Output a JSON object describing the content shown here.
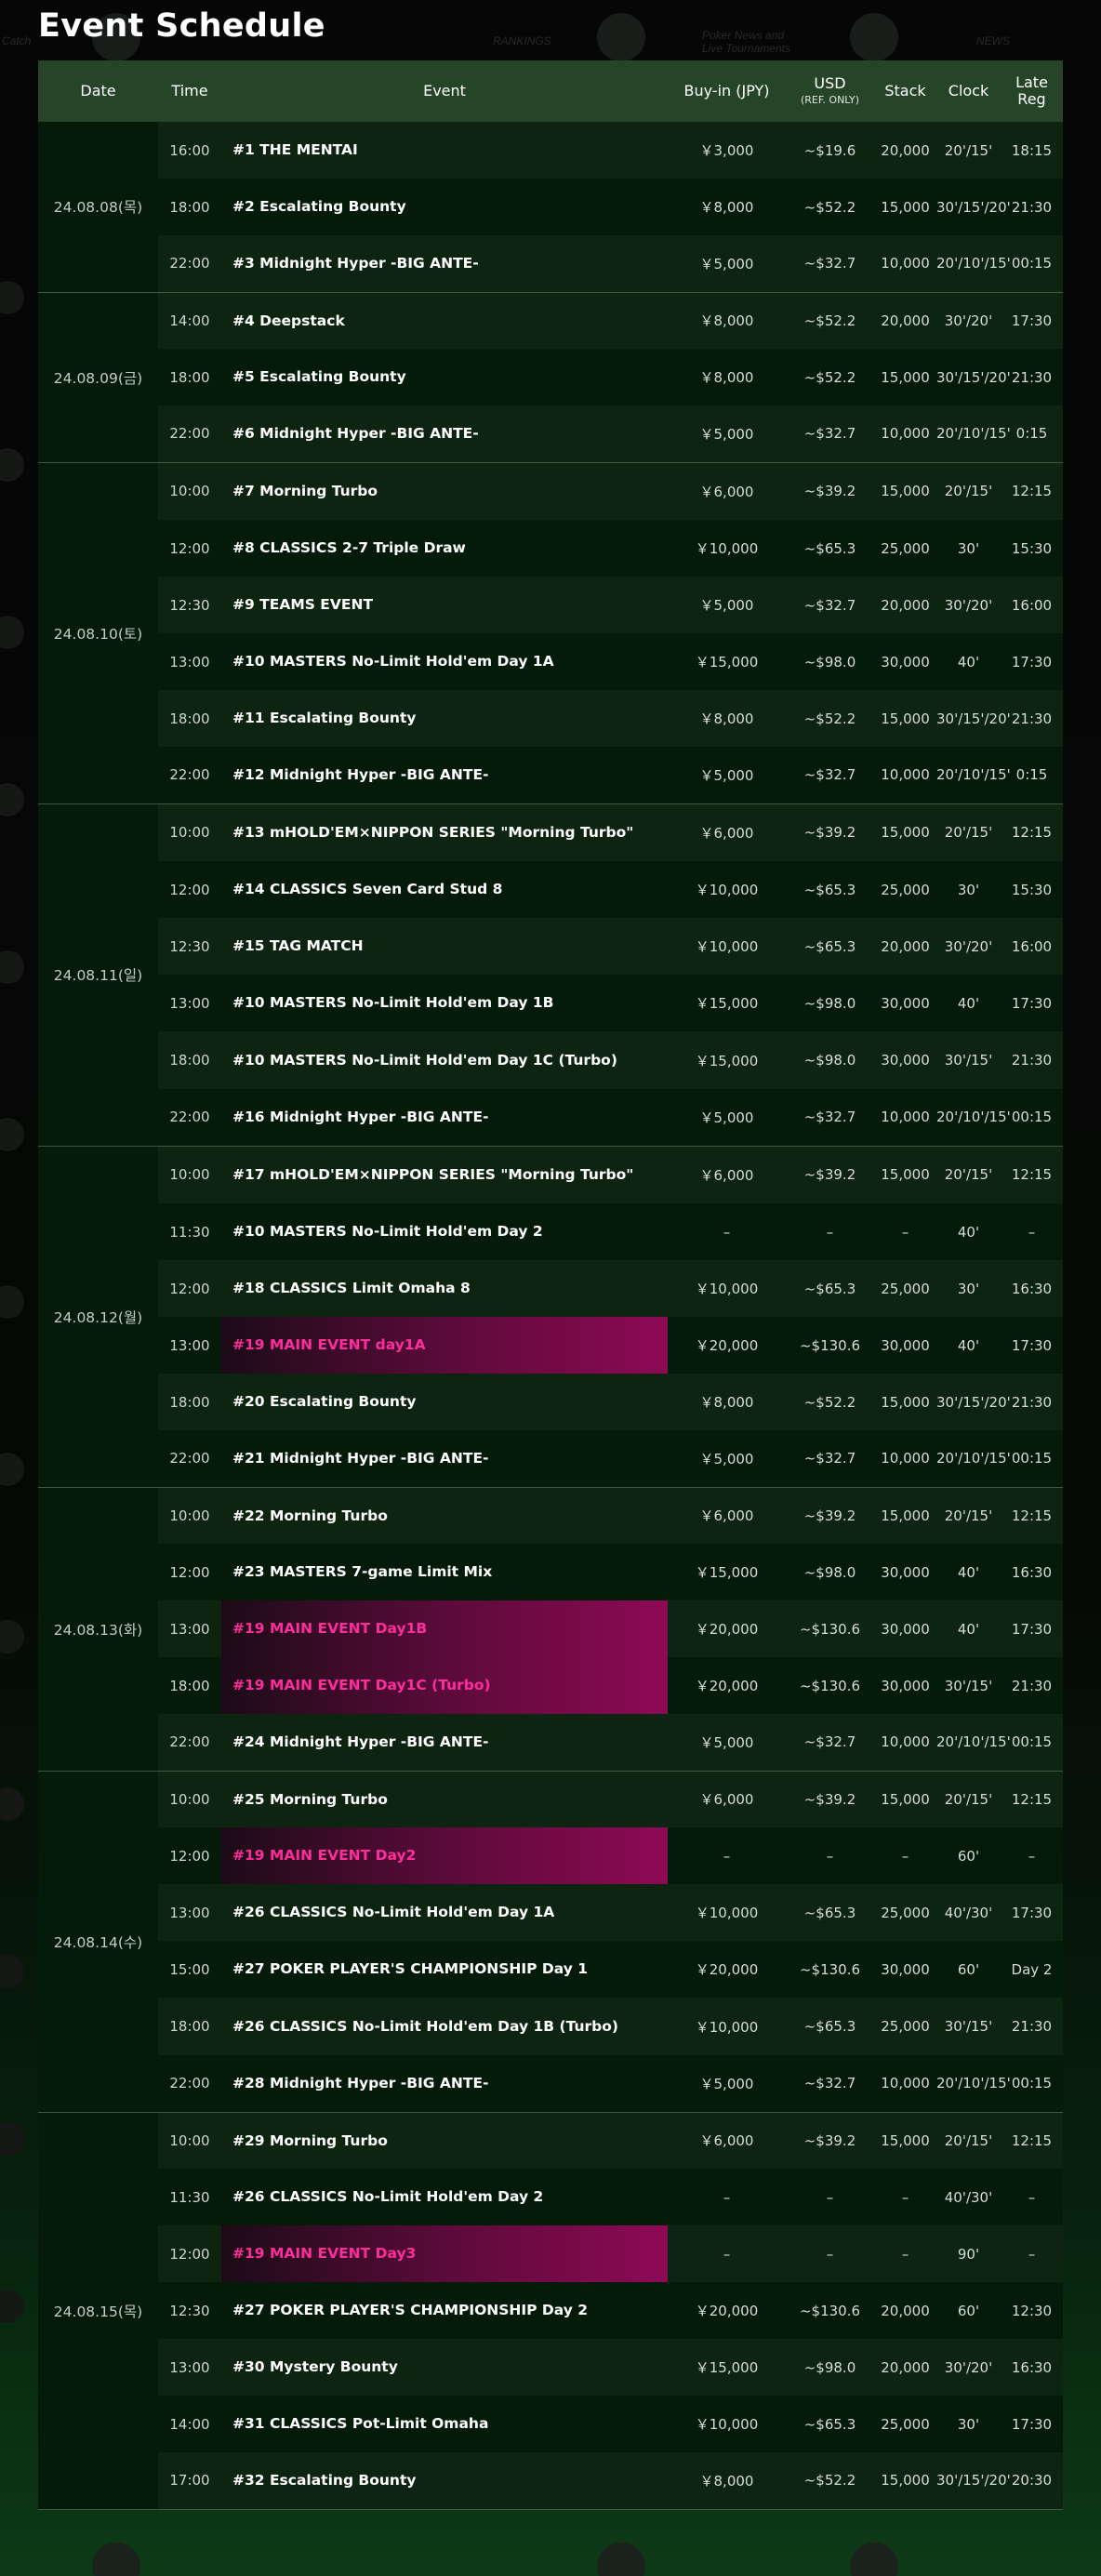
{
  "page": {
    "title": "Event Schedule",
    "bg_texts": [
      "RANKINGS",
      "NEWS",
      "Poker News and",
      "Live Tournaments",
      "Catch"
    ]
  },
  "colors": {
    "header_bg": "#254428",
    "row_even": "#0d2510",
    "row_odd": "#041b0a",
    "main_event_text": "#ff2d9c",
    "main_event_gradient_end": "#8e0a55"
  },
  "table": {
    "columns": {
      "date": "Date",
      "time": "Time",
      "event": "Event",
      "buyin": "Buy-in (JPY)",
      "usd": "USD",
      "usd_sub": "(REF. ONLY)",
      "stack": "Stack",
      "clock": "Clock",
      "latereg": "Late Reg"
    },
    "days": [
      {
        "date": "24.08.08(목)",
        "events": [
          {
            "time": "16:00",
            "name": "#1 THE MENTAI",
            "buyin": "￥3,000",
            "usd": "~$19.6",
            "stack": "20,000",
            "clock": "20'/15'",
            "latereg": "18:15",
            "main": false
          },
          {
            "time": "18:00",
            "name": "#2 Escalating Bounty",
            "buyin": "￥8,000",
            "usd": "~$52.2",
            "stack": "15,000",
            "clock": "30'/15'/20'",
            "latereg": "21:30",
            "main": false
          },
          {
            "time": "22:00",
            "name": "#3 Midnight Hyper -BIG ANTE-",
            "buyin": "￥5,000",
            "usd": "~$32.7",
            "stack": "10,000",
            "clock": "20'/10'/15'",
            "latereg": "00:15",
            "main": false
          }
        ]
      },
      {
        "date": "24.08.09(금)",
        "events": [
          {
            "time": "14:00",
            "name": "#4 Deepstack",
            "buyin": "￥8,000",
            "usd": "~$52.2",
            "stack": "20,000",
            "clock": "30'/20'",
            "latereg": "17:30",
            "main": false
          },
          {
            "time": "18:00",
            "name": "#5 Escalating Bounty",
            "buyin": "￥8,000",
            "usd": "~$52.2",
            "stack": "15,000",
            "clock": "30'/15'/20'",
            "latereg": "21:30",
            "main": false
          },
          {
            "time": "22:00",
            "name": "#6 Midnight Hyper -BIG ANTE-",
            "buyin": "￥5,000",
            "usd": "~$32.7",
            "stack": "10,000",
            "clock": "20'/10'/15'",
            "latereg": "0:15",
            "main": false
          }
        ]
      },
      {
        "date": "24.08.10(토)",
        "events": [
          {
            "time": "10:00",
            "name": "#7 Morning Turbo",
            "buyin": "￥6,000",
            "usd": "~$39.2",
            "stack": "15,000",
            "clock": "20'/15'",
            "latereg": "12:15",
            "main": false
          },
          {
            "time": "12:00",
            "name": "#8 CLASSICS 2-7 Triple Draw",
            "buyin": "￥10,000",
            "usd": "~$65.3",
            "stack": "25,000",
            "clock": "30'",
            "latereg": "15:30",
            "main": false
          },
          {
            "time": "12:30",
            "name": "#9 TEAMS EVENT",
            "buyin": "￥5,000",
            "usd": "~$32.7",
            "stack": "20,000",
            "clock": "30'/20'",
            "latereg": "16:00",
            "main": false
          },
          {
            "time": "13:00",
            "name": "#10 MASTERS No-Limit Hold'em Day 1A",
            "buyin": "￥15,000",
            "usd": "~$98.0",
            "stack": "30,000",
            "clock": "40'",
            "latereg": "17:30",
            "main": false
          },
          {
            "time": "18:00",
            "name": "#11 Escalating Bounty",
            "buyin": "￥8,000",
            "usd": "~$52.2",
            "stack": "15,000",
            "clock": "30'/15'/20'",
            "latereg": "21:30",
            "main": false
          },
          {
            "time": "22:00",
            "name": "#12 Midnight Hyper -BIG ANTE-",
            "buyin": "￥5,000",
            "usd": "~$32.7",
            "stack": "10,000",
            "clock": "20'/10'/15'",
            "latereg": "0:15",
            "main": false
          }
        ]
      },
      {
        "date": "24.08.11(일)",
        "events": [
          {
            "time": "10:00",
            "name": "#13 mHOLD'EM×NIPPON SERIES \"Morning Turbo\"",
            "buyin": "￥6,000",
            "usd": "~$39.2",
            "stack": "15,000",
            "clock": "20'/15'",
            "latereg": "12:15",
            "main": false
          },
          {
            "time": "12:00",
            "name": "#14 CLASSICS Seven Card Stud 8",
            "buyin": "￥10,000",
            "usd": "~$65.3",
            "stack": "25,000",
            "clock": "30'",
            "latereg": "15:30",
            "main": false
          },
          {
            "time": "12:30",
            "name": "#15 TAG MATCH",
            "buyin": "￥10,000",
            "usd": "~$65.3",
            "stack": "20,000",
            "clock": "30'/20'",
            "latereg": "16:00",
            "main": false
          },
          {
            "time": "13:00",
            "name": "#10 MASTERS No-Limit Hold'em Day 1B",
            "buyin": "￥15,000",
            "usd": "~$98.0",
            "stack": "30,000",
            "clock": "40'",
            "latereg": "17:30",
            "main": false
          },
          {
            "time": "18:00",
            "name": "#10 MASTERS No-Limit Hold'em Day 1C (Turbo)",
            "buyin": "￥15,000",
            "usd": "~$98.0",
            "stack": "30,000",
            "clock": "30'/15'",
            "latereg": "21:30",
            "main": false
          },
          {
            "time": "22:00",
            "name": "#16 Midnight Hyper -BIG ANTE-",
            "buyin": "￥5,000",
            "usd": "~$32.7",
            "stack": "10,000",
            "clock": "20'/10'/15'",
            "latereg": "00:15",
            "main": false
          }
        ]
      },
      {
        "date": "24.08.12(월)",
        "events": [
          {
            "time": "10:00",
            "name": "#17 mHOLD'EM×NIPPON SERIES \"Morning Turbo\"",
            "buyin": "￥6,000",
            "usd": "~$39.2",
            "stack": "15,000",
            "clock": "20'/15'",
            "latereg": "12:15",
            "main": false
          },
          {
            "time": "11:30",
            "name": "#10 MASTERS No-Limit Hold'em Day 2",
            "buyin": "–",
            "usd": "–",
            "stack": "–",
            "clock": "40'",
            "latereg": "–",
            "main": false
          },
          {
            "time": "12:00",
            "name": "#18 CLASSICS Limit Omaha 8",
            "buyin": "￥10,000",
            "usd": "~$65.3",
            "stack": "25,000",
            "clock": "30'",
            "latereg": "16:30",
            "main": false
          },
          {
            "time": "13:00",
            "name": "#19 MAIN EVENT day1A",
            "buyin": "￥20,000",
            "usd": "~$130.6",
            "stack": "30,000",
            "clock": "40'",
            "latereg": "17:30",
            "main": true
          },
          {
            "time": "18:00",
            "name": "#20 Escalating Bounty",
            "buyin": "￥8,000",
            "usd": "~$52.2",
            "stack": "15,000",
            "clock": "30'/15'/20'",
            "latereg": "21:30",
            "main": false
          },
          {
            "time": "22:00",
            "name": "#21 Midnight Hyper -BIG ANTE-",
            "buyin": "￥5,000",
            "usd": "~$32.7",
            "stack": "10,000",
            "clock": "20'/10'/15'",
            "latereg": "00:15",
            "main": false
          }
        ]
      },
      {
        "date": "24.08.13(화)",
        "events": [
          {
            "time": "10:00",
            "name": "#22 Morning Turbo",
            "buyin": "￥6,000",
            "usd": "~$39.2",
            "stack": "15,000",
            "clock": "20'/15'",
            "latereg": "12:15",
            "main": false
          },
          {
            "time": "12:00",
            "name": "#23 MASTERS 7-game Limit Mix",
            "buyin": "￥15,000",
            "usd": "~$98.0",
            "stack": "30,000",
            "clock": "40'",
            "latereg": "16:30",
            "main": false
          },
          {
            "time": "13:00",
            "name": "#19 MAIN EVENT Day1B",
            "buyin": "￥20,000",
            "usd": "~$130.6",
            "stack": "30,000",
            "clock": "40'",
            "latereg": "17:30",
            "main": true
          },
          {
            "time": "18:00",
            "name": "#19 MAIN EVENT Day1C (Turbo)",
            "buyin": "￥20,000",
            "usd": "~$130.6",
            "stack": "30,000",
            "clock": "30'/15'",
            "latereg": "21:30",
            "main": true
          },
          {
            "time": "22:00",
            "name": "#24 Midnight Hyper -BIG ANTE-",
            "buyin": "￥5,000",
            "usd": "~$32.7",
            "stack": "10,000",
            "clock": "20'/10'/15'",
            "latereg": "00:15",
            "main": false
          }
        ]
      },
      {
        "date": "24.08.14(수)",
        "events": [
          {
            "time": "10:00",
            "name": "#25 Morning Turbo",
            "buyin": "￥6,000",
            "usd": "~$39.2",
            "stack": "15,000",
            "clock": "20'/15'",
            "latereg": "12:15",
            "main": false
          },
          {
            "time": "12:00",
            "name": "#19 MAIN EVENT Day2",
            "buyin": "–",
            "usd": "–",
            "stack": "–",
            "clock": "60'",
            "latereg": "–",
            "main": true
          },
          {
            "time": "13:00",
            "name": "#26 CLASSICS No-Limit Hold'em Day 1A",
            "buyin": "￥10,000",
            "usd": "~$65.3",
            "stack": "25,000",
            "clock": "40'/30'",
            "latereg": "17:30",
            "main": false
          },
          {
            "time": "15:00",
            "name": "#27 POKER PLAYER'S CHAMPIONSHIP Day 1",
            "buyin": "￥20,000",
            "usd": "~$130.6",
            "stack": "30,000",
            "clock": "60'",
            "latereg": "Day 2",
            "main": false
          },
          {
            "time": "18:00",
            "name": "#26 CLASSICS No-Limit Hold'em Day 1B (Turbo)",
            "buyin": "￥10,000",
            "usd": "~$65.3",
            "stack": "25,000",
            "clock": "30'/15'",
            "latereg": "21:30",
            "main": false
          },
          {
            "time": "22:00",
            "name": "#28 Midnight Hyper -BIG ANTE-",
            "buyin": "￥5,000",
            "usd": "~$32.7",
            "stack": "10,000",
            "clock": "20'/10'/15'",
            "latereg": "00:15",
            "main": false
          }
        ]
      },
      {
        "date": "24.08.15(목)",
        "events": [
          {
            "time": "10:00",
            "name": "#29 Morning Turbo",
            "buyin": "￥6,000",
            "usd": "~$39.2",
            "stack": "15,000",
            "clock": "20'/15'",
            "latereg": "12:15",
            "main": false
          },
          {
            "time": "11:30",
            "name": "#26 CLASSICS No-Limit Hold'em Day 2",
            "buyin": "–",
            "usd": "–",
            "stack": "–",
            "clock": "40'/30'",
            "latereg": "–",
            "main": false
          },
          {
            "time": "12:00",
            "name": "#19 MAIN EVENT Day3",
            "buyin": "–",
            "usd": "–",
            "stack": "–",
            "clock": "90'",
            "latereg": "–",
            "main": true
          },
          {
            "time": "12:30",
            "name": "#27 POKER PLAYER'S CHAMPIONSHIP Day 2",
            "buyin": "￥20,000",
            "usd": "~$130.6",
            "stack": "20,000",
            "clock": "60'",
            "latereg": "12:30",
            "main": false
          },
          {
            "time": "13:00",
            "name": "#30 Mystery Bounty",
            "buyin": "￥15,000",
            "usd": "~$98.0",
            "stack": "20,000",
            "clock": "30'/20'",
            "latereg": "16:30",
            "main": false
          },
          {
            "time": "14:00",
            "name": "#31 CLASSICS Pot-Limit Omaha",
            "buyin": "￥10,000",
            "usd": "~$65.3",
            "stack": "25,000",
            "clock": "30'",
            "latereg": "17:30",
            "main": false
          },
          {
            "time": "17:00",
            "name": "#32 Escalating Bounty",
            "buyin": "￥8,000",
            "usd": "~$52.2",
            "stack": "15,000",
            "clock": "30'/15'/20'",
            "latereg": "20:30",
            "main": false
          }
        ]
      }
    ]
  }
}
